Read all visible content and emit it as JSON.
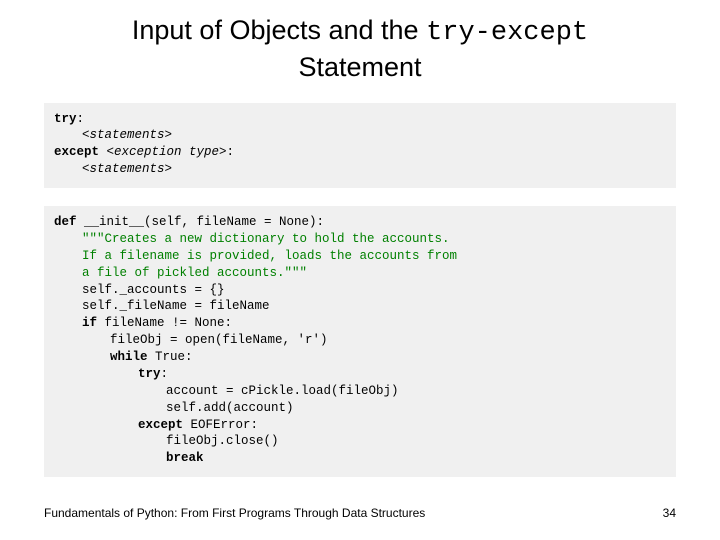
{
  "title": {
    "part1": "Input of Objects and the ",
    "mono": "try-except",
    "part2": "Statement"
  },
  "block1": {
    "l1a": "try",
    "l1b": ":",
    "l2": "<statements>",
    "l3a": "except",
    "l3b": " <exception type>",
    "l3c": ":",
    "l4": "<statements>"
  },
  "block2": {
    "l1a": "def",
    "l1b": " __init__(self, fileName = None):",
    "l2": "\"\"\"Creates a new dictionary to hold the accounts.",
    "l3": "If a filename is provided, loads the accounts from",
    "l4": "a file of pickled accounts.\"\"\"",
    "l5": "self._accounts = {}",
    "l6": "self._fileName = fileName",
    "l7a": "if",
    "l7b": " fileName != None:",
    "l8": "fileObj = open(fileName, 'r')",
    "l9a": "while",
    "l9b": " True:",
    "l10a": "try",
    "l10b": ":",
    "l11": "account = cPickle.load(fileObj)",
    "l12": "self.add(account)",
    "l13a": "except",
    "l13b": " EOFError:",
    "l14": "fileObj.close()",
    "l15": "break"
  },
  "footer": {
    "text": "Fundamentals of Python: From First Programs Through Data Structures",
    "page": "34"
  }
}
